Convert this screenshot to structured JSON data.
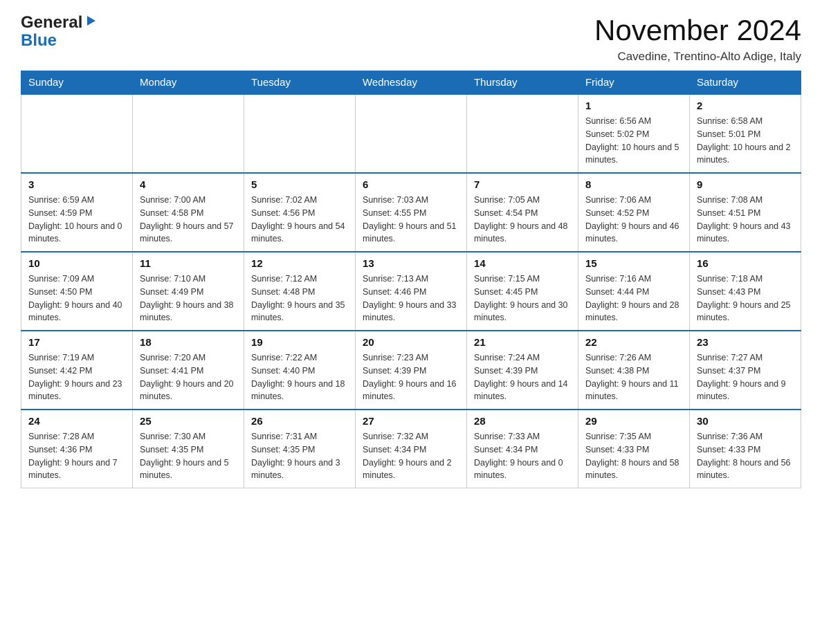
{
  "header": {
    "logo_text1": "General",
    "logo_text2": "Blue",
    "month_title": "November 2024",
    "subtitle": "Cavedine, Trentino-Alto Adige, Italy"
  },
  "days_of_week": [
    "Sunday",
    "Monday",
    "Tuesday",
    "Wednesday",
    "Thursday",
    "Friday",
    "Saturday"
  ],
  "weeks": [
    [
      {
        "day": "",
        "sunrise": "",
        "sunset": "",
        "daylight": ""
      },
      {
        "day": "",
        "sunrise": "",
        "sunset": "",
        "daylight": ""
      },
      {
        "day": "",
        "sunrise": "",
        "sunset": "",
        "daylight": ""
      },
      {
        "day": "",
        "sunrise": "",
        "sunset": "",
        "daylight": ""
      },
      {
        "day": "",
        "sunrise": "",
        "sunset": "",
        "daylight": ""
      },
      {
        "day": "1",
        "sunrise": "Sunrise: 6:56 AM",
        "sunset": "Sunset: 5:02 PM",
        "daylight": "Daylight: 10 hours and 5 minutes."
      },
      {
        "day": "2",
        "sunrise": "Sunrise: 6:58 AM",
        "sunset": "Sunset: 5:01 PM",
        "daylight": "Daylight: 10 hours and 2 minutes."
      }
    ],
    [
      {
        "day": "3",
        "sunrise": "Sunrise: 6:59 AM",
        "sunset": "Sunset: 4:59 PM",
        "daylight": "Daylight: 10 hours and 0 minutes."
      },
      {
        "day": "4",
        "sunrise": "Sunrise: 7:00 AM",
        "sunset": "Sunset: 4:58 PM",
        "daylight": "Daylight: 9 hours and 57 minutes."
      },
      {
        "day": "5",
        "sunrise": "Sunrise: 7:02 AM",
        "sunset": "Sunset: 4:56 PM",
        "daylight": "Daylight: 9 hours and 54 minutes."
      },
      {
        "day": "6",
        "sunrise": "Sunrise: 7:03 AM",
        "sunset": "Sunset: 4:55 PM",
        "daylight": "Daylight: 9 hours and 51 minutes."
      },
      {
        "day": "7",
        "sunrise": "Sunrise: 7:05 AM",
        "sunset": "Sunset: 4:54 PM",
        "daylight": "Daylight: 9 hours and 48 minutes."
      },
      {
        "day": "8",
        "sunrise": "Sunrise: 7:06 AM",
        "sunset": "Sunset: 4:52 PM",
        "daylight": "Daylight: 9 hours and 46 minutes."
      },
      {
        "day": "9",
        "sunrise": "Sunrise: 7:08 AM",
        "sunset": "Sunset: 4:51 PM",
        "daylight": "Daylight: 9 hours and 43 minutes."
      }
    ],
    [
      {
        "day": "10",
        "sunrise": "Sunrise: 7:09 AM",
        "sunset": "Sunset: 4:50 PM",
        "daylight": "Daylight: 9 hours and 40 minutes."
      },
      {
        "day": "11",
        "sunrise": "Sunrise: 7:10 AM",
        "sunset": "Sunset: 4:49 PM",
        "daylight": "Daylight: 9 hours and 38 minutes."
      },
      {
        "day": "12",
        "sunrise": "Sunrise: 7:12 AM",
        "sunset": "Sunset: 4:48 PM",
        "daylight": "Daylight: 9 hours and 35 minutes."
      },
      {
        "day": "13",
        "sunrise": "Sunrise: 7:13 AM",
        "sunset": "Sunset: 4:46 PM",
        "daylight": "Daylight: 9 hours and 33 minutes."
      },
      {
        "day": "14",
        "sunrise": "Sunrise: 7:15 AM",
        "sunset": "Sunset: 4:45 PM",
        "daylight": "Daylight: 9 hours and 30 minutes."
      },
      {
        "day": "15",
        "sunrise": "Sunrise: 7:16 AM",
        "sunset": "Sunset: 4:44 PM",
        "daylight": "Daylight: 9 hours and 28 minutes."
      },
      {
        "day": "16",
        "sunrise": "Sunrise: 7:18 AM",
        "sunset": "Sunset: 4:43 PM",
        "daylight": "Daylight: 9 hours and 25 minutes."
      }
    ],
    [
      {
        "day": "17",
        "sunrise": "Sunrise: 7:19 AM",
        "sunset": "Sunset: 4:42 PM",
        "daylight": "Daylight: 9 hours and 23 minutes."
      },
      {
        "day": "18",
        "sunrise": "Sunrise: 7:20 AM",
        "sunset": "Sunset: 4:41 PM",
        "daylight": "Daylight: 9 hours and 20 minutes."
      },
      {
        "day": "19",
        "sunrise": "Sunrise: 7:22 AM",
        "sunset": "Sunset: 4:40 PM",
        "daylight": "Daylight: 9 hours and 18 minutes."
      },
      {
        "day": "20",
        "sunrise": "Sunrise: 7:23 AM",
        "sunset": "Sunset: 4:39 PM",
        "daylight": "Daylight: 9 hours and 16 minutes."
      },
      {
        "day": "21",
        "sunrise": "Sunrise: 7:24 AM",
        "sunset": "Sunset: 4:39 PM",
        "daylight": "Daylight: 9 hours and 14 minutes."
      },
      {
        "day": "22",
        "sunrise": "Sunrise: 7:26 AM",
        "sunset": "Sunset: 4:38 PM",
        "daylight": "Daylight: 9 hours and 11 minutes."
      },
      {
        "day": "23",
        "sunrise": "Sunrise: 7:27 AM",
        "sunset": "Sunset: 4:37 PM",
        "daylight": "Daylight: 9 hours and 9 minutes."
      }
    ],
    [
      {
        "day": "24",
        "sunrise": "Sunrise: 7:28 AM",
        "sunset": "Sunset: 4:36 PM",
        "daylight": "Daylight: 9 hours and 7 minutes."
      },
      {
        "day": "25",
        "sunrise": "Sunrise: 7:30 AM",
        "sunset": "Sunset: 4:35 PM",
        "daylight": "Daylight: 9 hours and 5 minutes."
      },
      {
        "day": "26",
        "sunrise": "Sunrise: 7:31 AM",
        "sunset": "Sunset: 4:35 PM",
        "daylight": "Daylight: 9 hours and 3 minutes."
      },
      {
        "day": "27",
        "sunrise": "Sunrise: 7:32 AM",
        "sunset": "Sunset: 4:34 PM",
        "daylight": "Daylight: 9 hours and 2 minutes."
      },
      {
        "day": "28",
        "sunrise": "Sunrise: 7:33 AM",
        "sunset": "Sunset: 4:34 PM",
        "daylight": "Daylight: 9 hours and 0 minutes."
      },
      {
        "day": "29",
        "sunrise": "Sunrise: 7:35 AM",
        "sunset": "Sunset: 4:33 PM",
        "daylight": "Daylight: 8 hours and 58 minutes."
      },
      {
        "day": "30",
        "sunrise": "Sunrise: 7:36 AM",
        "sunset": "Sunset: 4:33 PM",
        "daylight": "Daylight: 8 hours and 56 minutes."
      }
    ]
  ]
}
